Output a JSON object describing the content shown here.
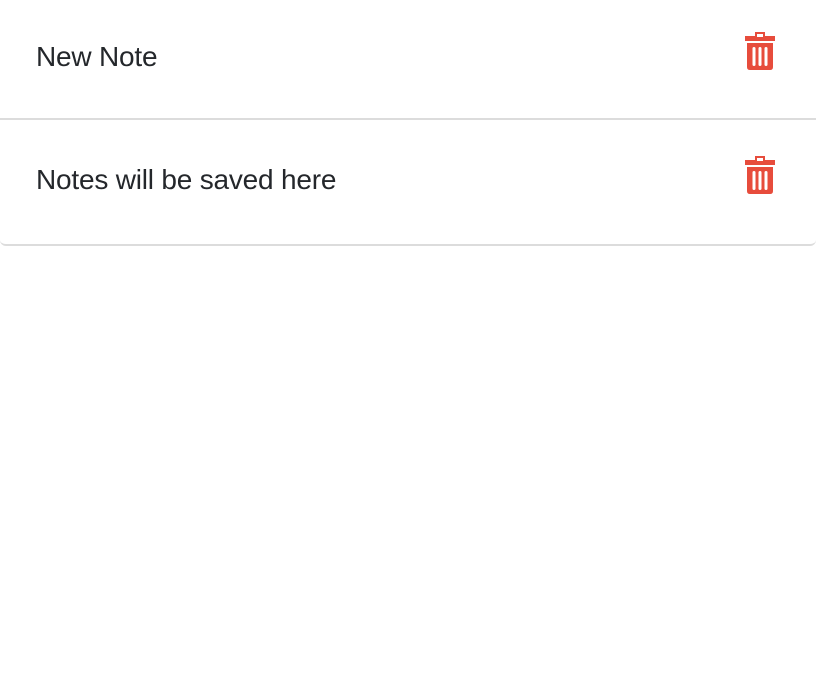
{
  "notes": [
    {
      "title": "New Note",
      "delete_icon": "trash-icon"
    },
    {
      "title": "Notes will be saved here",
      "delete_icon": "trash-icon"
    }
  ],
  "colors": {
    "delete": "#e74c3c",
    "text": "#24272b",
    "divider": "#dcdcdc"
  }
}
